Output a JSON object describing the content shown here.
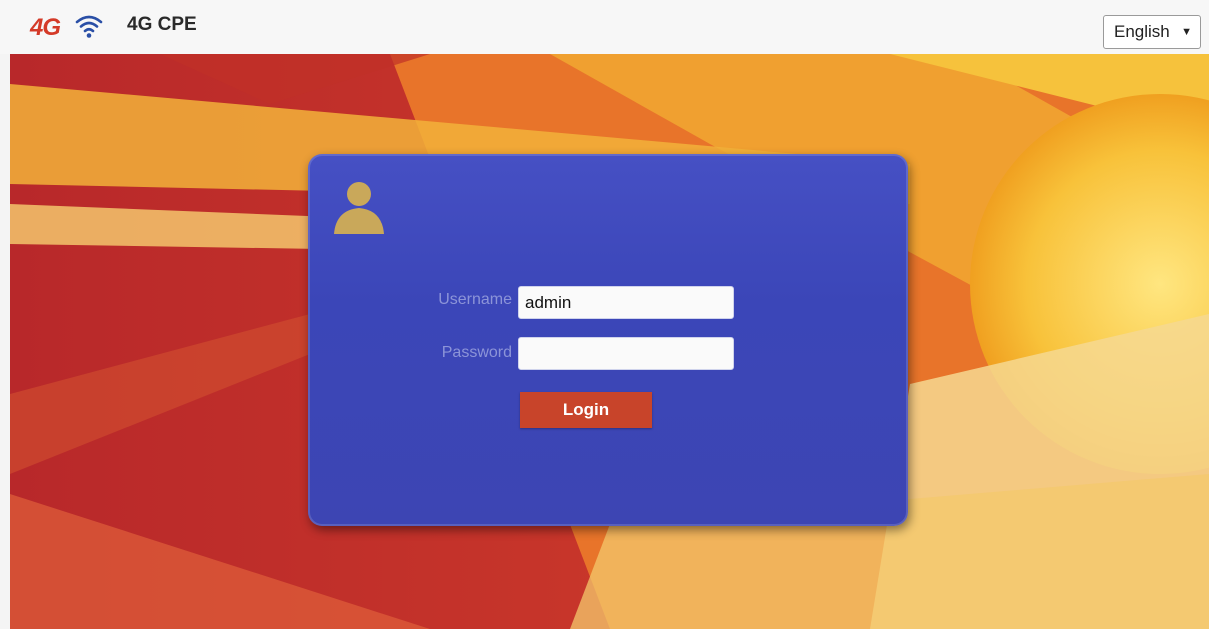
{
  "header": {
    "logo_text": "4G",
    "product_name": "4G CPE",
    "language": {
      "selected": "English",
      "arrow": "▼"
    }
  },
  "login": {
    "username_label": "Username",
    "username_value": "admin",
    "password_label": "Password",
    "password_value": "",
    "button_label": "Login"
  },
  "icons": {
    "wifi": "wifi-icon",
    "avatar": "user-avatar-icon"
  },
  "colors": {
    "brand_red": "#d43a28",
    "card_blue": "#3d45b3",
    "button_red": "#c8442a"
  }
}
